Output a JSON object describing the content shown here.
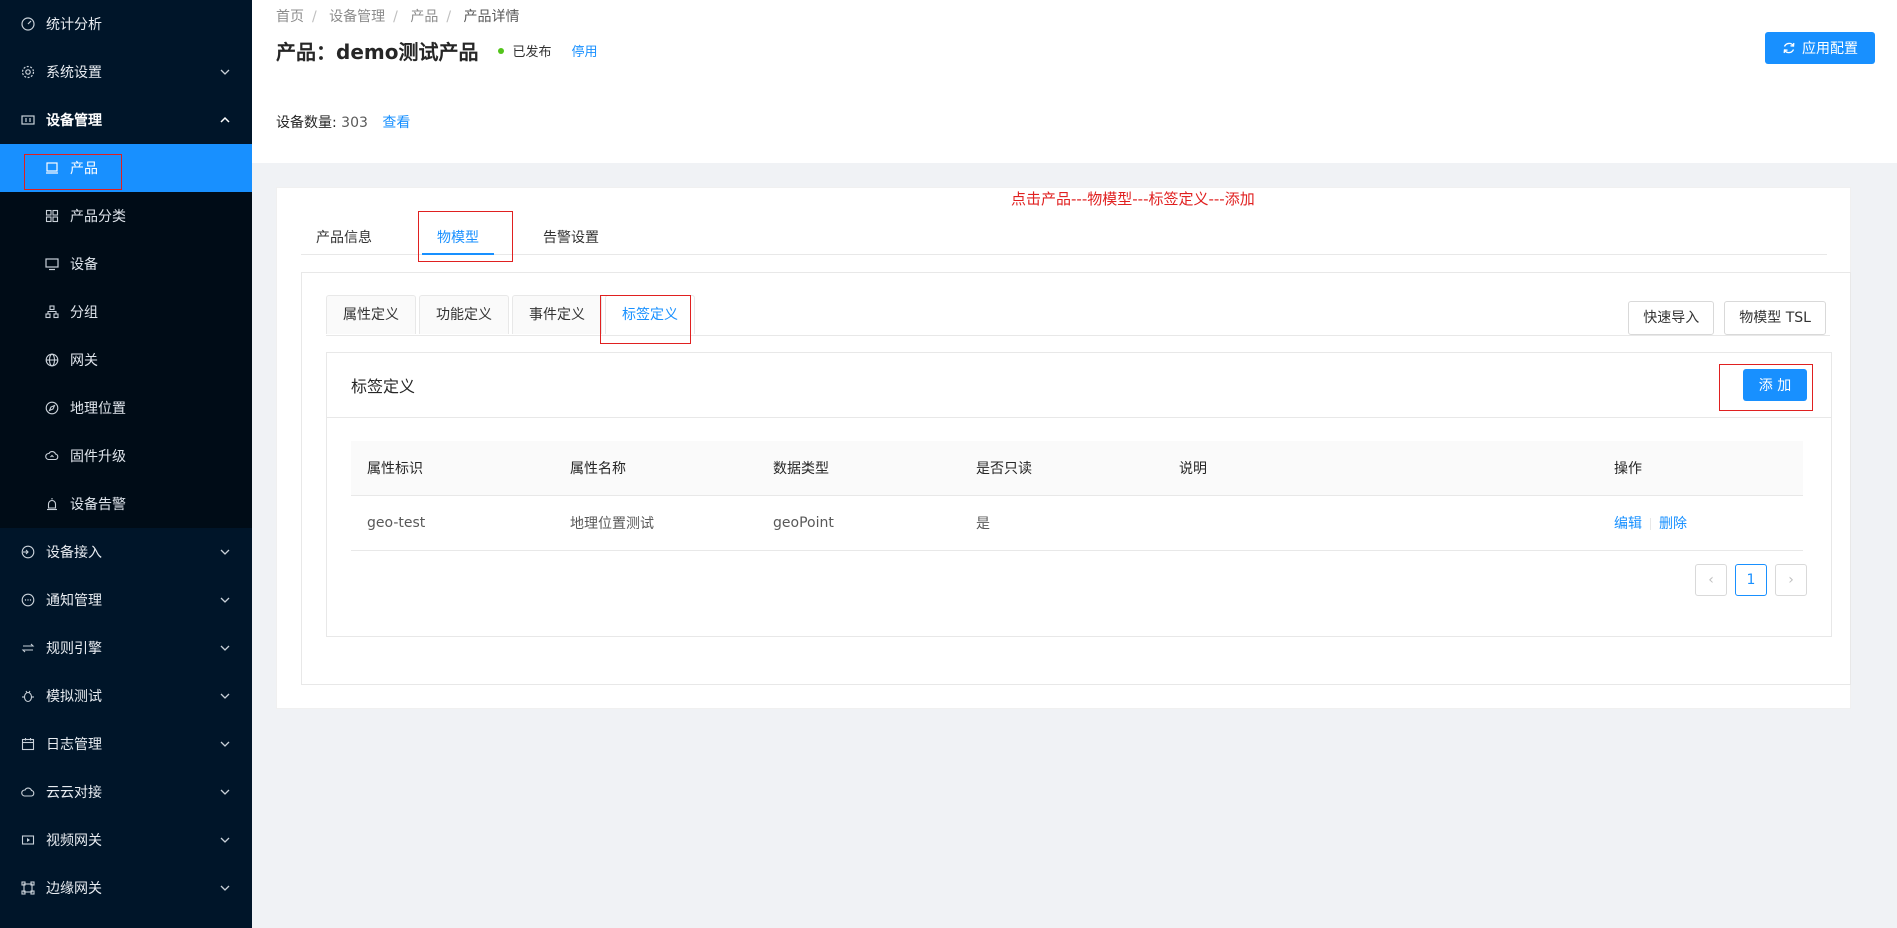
{
  "sidebar": {
    "items": [
      {
        "label": "统计分析",
        "icon": "dashboard-icon",
        "has_chevron": false
      },
      {
        "label": "系统设置",
        "icon": "gear-icon",
        "has_chevron": true
      },
      {
        "label": "设备管理",
        "icon": "device-manage-icon",
        "has_chevron": true,
        "expanded": true
      }
    ],
    "sub_items": [
      {
        "label": "产品",
        "icon": "product-icon",
        "active": true
      },
      {
        "label": "产品分类",
        "icon": "category-icon"
      },
      {
        "label": "设备",
        "icon": "monitor-icon"
      },
      {
        "label": "分组",
        "icon": "group-icon"
      },
      {
        "label": "网关",
        "icon": "globe-icon"
      },
      {
        "label": "地理位置",
        "icon": "compass-icon"
      },
      {
        "label": "固件升级",
        "icon": "cloud-upload-icon"
      },
      {
        "label": "设备告警",
        "icon": "alarm-icon"
      }
    ],
    "bottom_items": [
      {
        "label": "设备接入",
        "icon": "login-icon"
      },
      {
        "label": "通知管理",
        "icon": "message-icon"
      },
      {
        "label": "规则引擎",
        "icon": "swap-icon"
      },
      {
        "label": "模拟测试",
        "icon": "bug-icon"
      },
      {
        "label": "日志管理",
        "icon": "calendar-icon"
      },
      {
        "label": "云云对接",
        "icon": "cloud-icon"
      },
      {
        "label": "视频网关",
        "icon": "video-icon"
      },
      {
        "label": "边缘网关",
        "icon": "edge-icon"
      }
    ]
  },
  "header": {
    "breadcrumb": [
      "首页",
      "设备管理",
      "产品",
      "产品详情"
    ],
    "title": "产品：demo测试产品",
    "status": "已发布",
    "stop_link": "停用",
    "apply_button": "应用配置",
    "device_count_label": "设备数量:",
    "device_count": "303",
    "view_link": "查看"
  },
  "annotation": "点击产品---物模型---标签定义---添加",
  "main_tabs": [
    "产品信息",
    "物模型",
    "告警设置"
  ],
  "sub_tabs": [
    "属性定义",
    "功能定义",
    "事件定义",
    "标签定义"
  ],
  "right_buttons": {
    "quick_import": "快速导入",
    "tsl": "物模型 TSL"
  },
  "panel": {
    "title": "标签定义",
    "add_button": "添 加"
  },
  "table": {
    "headers": [
      "属性标识",
      "属性名称",
      "数据类型",
      "是否只读",
      "说明",
      "操作"
    ],
    "rows": [
      {
        "id": "geo-test",
        "name": "地理位置测试",
        "type": "geoPoint",
        "readonly": "是",
        "desc": "",
        "edit": "编辑",
        "delete": "删除"
      }
    ]
  },
  "pagination": {
    "current": "1",
    "prev": "‹",
    "next": "›"
  },
  "colors": {
    "sidebar_bg": "#001529",
    "accent": "#1890ff",
    "annotation": "#e02020",
    "published": "#52c41a"
  }
}
